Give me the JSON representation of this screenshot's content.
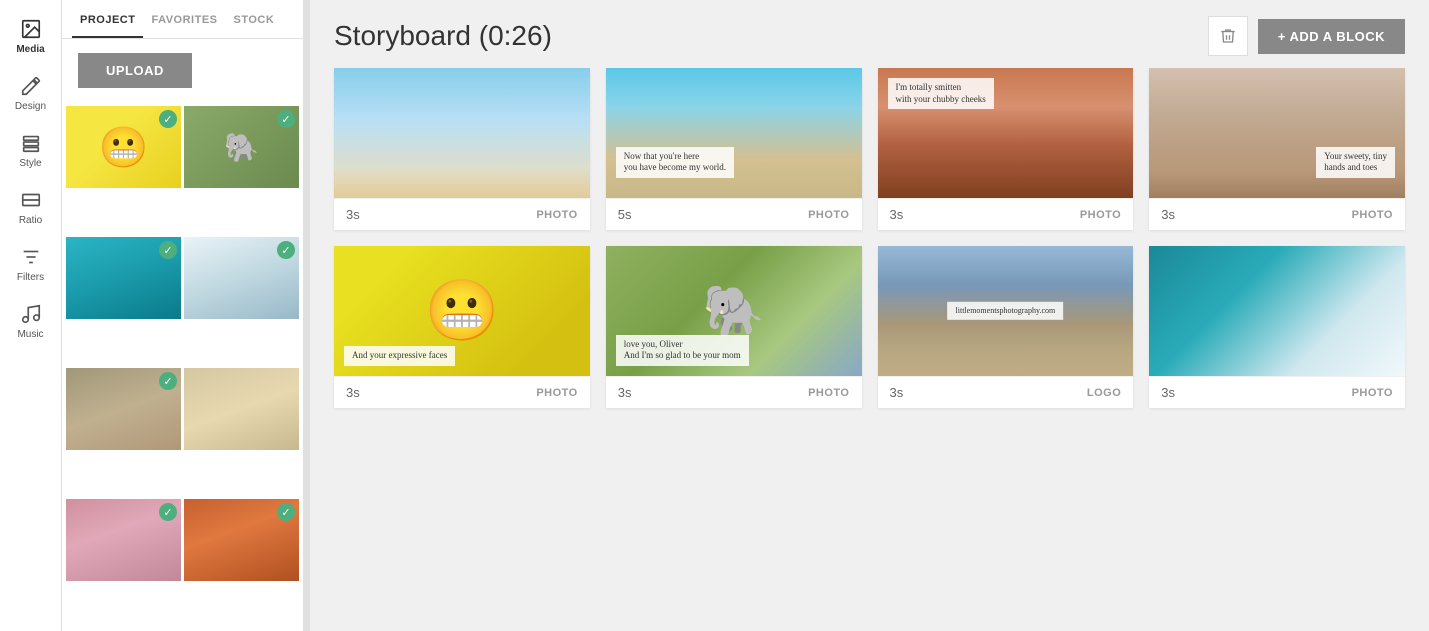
{
  "iconBar": {
    "items": [
      {
        "name": "media",
        "label": "Media",
        "icon": "image",
        "active": true
      },
      {
        "name": "design",
        "label": "Design",
        "icon": "brush"
      },
      {
        "name": "style",
        "label": "Style",
        "icon": "layers"
      },
      {
        "name": "ratio",
        "label": "Ratio",
        "icon": "ratio"
      },
      {
        "name": "filters",
        "label": "Filters",
        "icon": "filters"
      },
      {
        "name": "music",
        "label": "Music",
        "icon": "music"
      }
    ]
  },
  "sidebar": {
    "title": "Media",
    "tabs": [
      "Project",
      "Favorites",
      "Stock"
    ],
    "activeTab": "Project",
    "uploadButton": "Upload",
    "mediaItems": [
      {
        "id": 1,
        "type": "emoji",
        "checked": true
      },
      {
        "id": 2,
        "type": "elephants",
        "checked": true
      },
      {
        "id": 3,
        "type": "ocean1",
        "checked": true
      },
      {
        "id": 4,
        "type": "ocean2",
        "checked": true
      },
      {
        "id": 5,
        "type": "statue",
        "checked": true
      },
      {
        "id": 6,
        "type": "beach",
        "checked": false
      },
      {
        "id": 7,
        "type": "pink",
        "checked": true
      },
      {
        "id": 8,
        "type": "orange",
        "checked": true
      }
    ]
  },
  "main": {
    "title": "Storyboard (0:26)",
    "deleteButton": "",
    "addBlockButton": "+ ADD A BLOCK",
    "rows": [
      {
        "blocks": [
          {
            "duration": "3s",
            "type": "PHOTO",
            "preview": "sky",
            "overlay": null
          },
          {
            "duration": "5s",
            "type": "PHOTO",
            "preview": "coast",
            "overlay": "Now that you're here\nyou have become my world."
          },
          {
            "duration": "3s",
            "type": "PHOTO",
            "preview": "canyon",
            "overlay": "I'm totally smitten\nwith your chubby cheeks"
          },
          {
            "duration": "3s",
            "type": "PHOTO",
            "preview": "desert",
            "overlay": "Your sweety, tiny\nhands and toes"
          }
        ]
      },
      {
        "blocks": [
          {
            "duration": "3s",
            "type": "PHOTO",
            "preview": "emoji",
            "overlay": "And your expressive faces"
          },
          {
            "duration": "3s",
            "type": "PHOTO",
            "preview": "elephants",
            "overlay": "love you, Oliver\nAnd I'm so glad to be your mom"
          },
          {
            "duration": "3s",
            "type": "LOGO",
            "preview": "statue",
            "overlay": "littlemomentsphotography.com"
          },
          {
            "duration": "3s",
            "type": "PHOTO",
            "preview": "ocean-white",
            "overlay": null
          }
        ]
      }
    ]
  }
}
